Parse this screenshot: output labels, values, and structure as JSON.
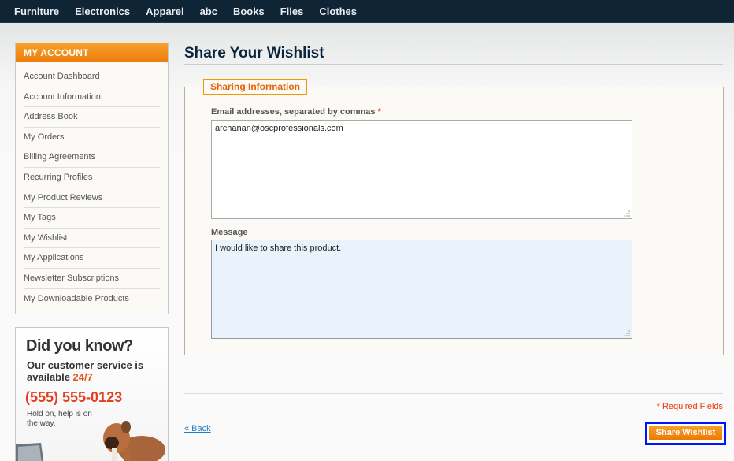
{
  "nav": {
    "items": [
      "Furniture",
      "Electronics",
      "Apparel",
      "abc",
      "Books",
      "Files",
      "Clothes"
    ]
  },
  "sidebar": {
    "title": "MY ACCOUNT",
    "items": [
      "Account Dashboard",
      "Account Information",
      "Address Book",
      "My Orders",
      "Billing Agreements",
      "Recurring Profiles",
      "My Product Reviews",
      "My Tags",
      "My Wishlist",
      "My Applications",
      "Newsletter Subscriptions",
      "My Downloadable Products"
    ]
  },
  "promo": {
    "heading": "Did you know?",
    "line1": "Our customer service is available ",
    "line1_highlight": "24/7",
    "phone": "(555) 555-0123",
    "small": "Hold on, help is on the way."
  },
  "main": {
    "title": "Share Your Wishlist",
    "legend": "Sharing Information",
    "email_label": "Email addresses, separated by commas",
    "required_mark": "*",
    "email_value": "archanan@oscprofessionals.com",
    "message_label": "Message",
    "message_value": "I would like  to share this product.",
    "required_note": "* Required Fields",
    "back_label": "« Back",
    "share_label": "Share Wishlist"
  },
  "colors": {
    "accent": "#ed7d0b",
    "nav_bg": "#0f2435",
    "link": "#1e7ec8",
    "required": "#eb340a",
    "focus_outline": "#0015ff"
  }
}
